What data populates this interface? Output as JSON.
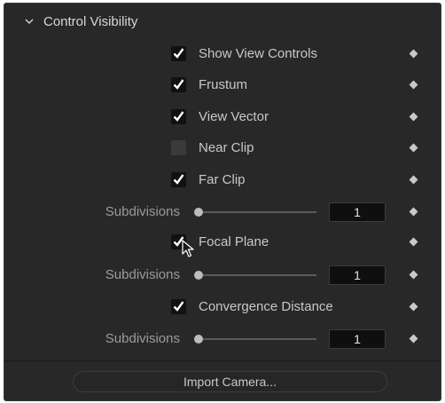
{
  "section": {
    "title": "Control Visibility",
    "expanded": true,
    "icon": "chevron-down-icon"
  },
  "controls": {
    "show_view_controls": {
      "label": "Show View Controls",
      "checked": true
    },
    "frustum": {
      "label": "Frustum",
      "checked": true
    },
    "view_vector": {
      "label": "View Vector",
      "checked": true
    },
    "near_clip": {
      "label": "Near Clip",
      "checked": false
    },
    "far_clip": {
      "label": "Far Clip",
      "checked": true
    },
    "far_clip_subdivisions": {
      "label": "Subdivisions",
      "value": "1"
    },
    "focal_plane": {
      "label": "Focal Plane",
      "checked": true
    },
    "focal_plane_subdivisions": {
      "label": "Subdivisions",
      "value": "1"
    },
    "convergence_distance": {
      "label": "Convergence Distance",
      "checked": true
    },
    "convergence_subdivisions": {
      "label": "Subdivisions",
      "value": "1"
    }
  },
  "import_button": {
    "label": "Import Camera..."
  },
  "colors": {
    "panel_bg": "#282828",
    "field_bg": "#0f0f0f",
    "text": "#c8c8c8",
    "muted_text": "#9c9c9c",
    "check_mark": "#ffffff"
  }
}
